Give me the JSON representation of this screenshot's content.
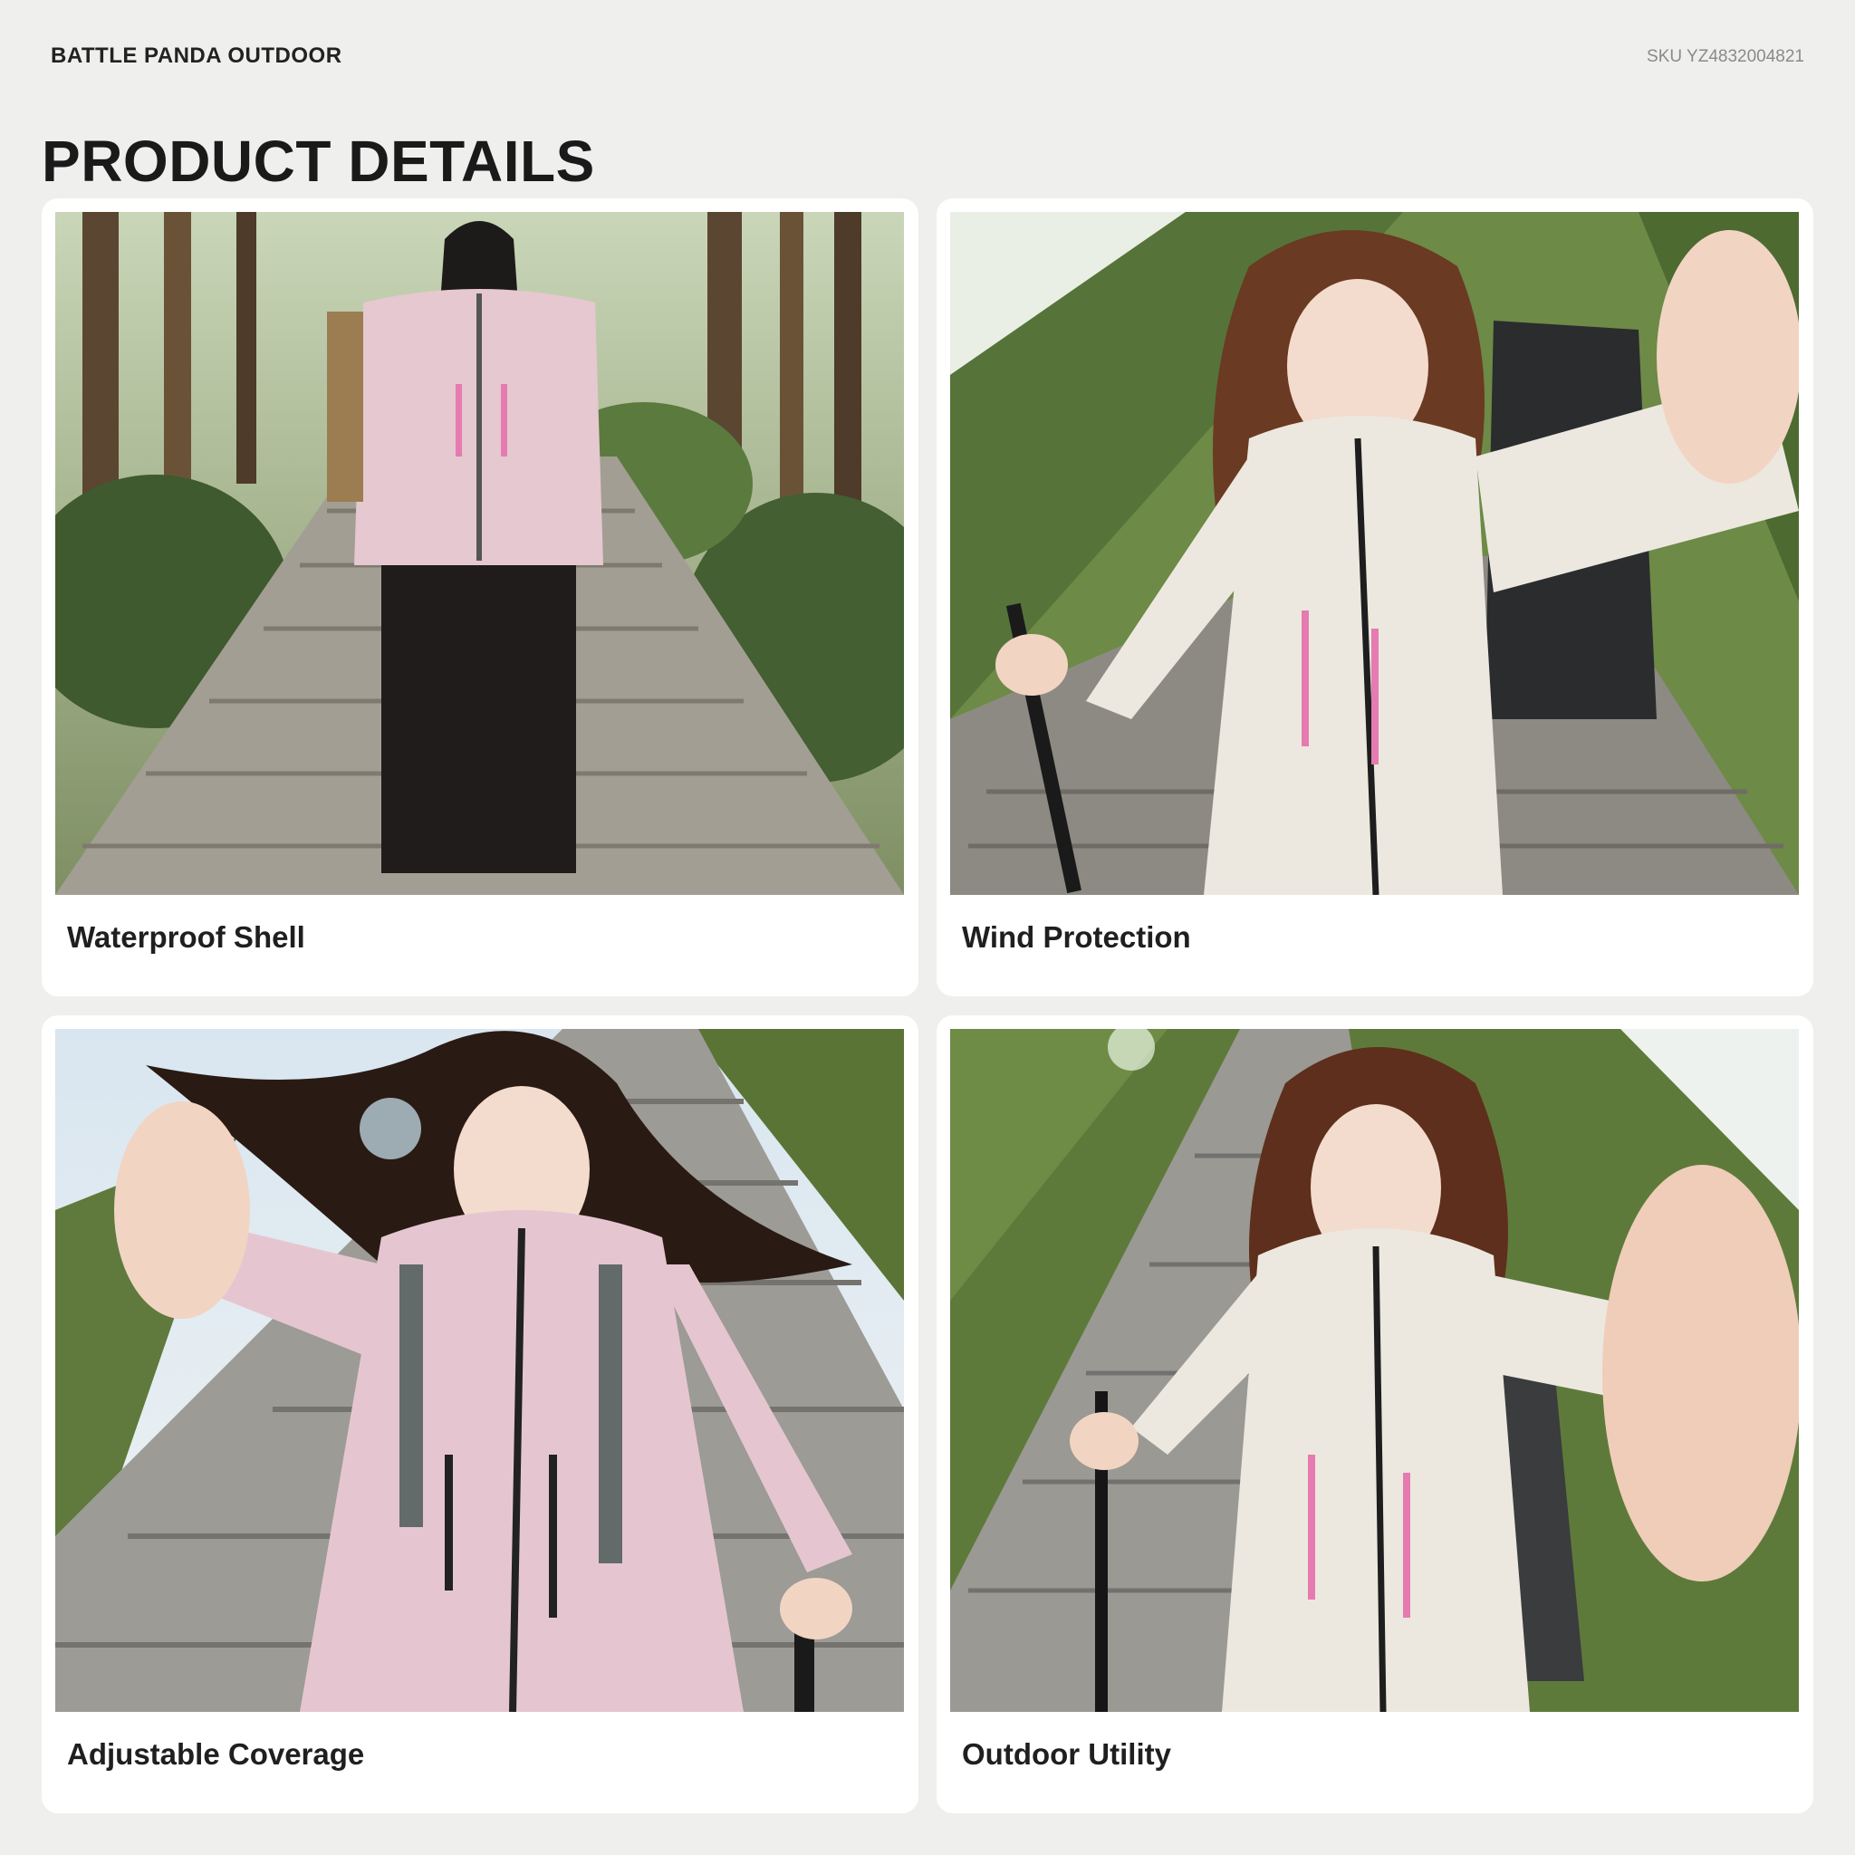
{
  "header": {
    "brand": "BATTLE PANDA OUTDOOR",
    "sku": "SKU YZ4832004821"
  },
  "page_title": "PRODUCT DETAILS",
  "cards": [
    {
      "caption": "Waterproof Shell",
      "photo_description_icon": "hiker-pink-jacket-forest-stairs",
      "jacket_color": "#e6c8d0",
      "accent_color": "#e57bb0"
    },
    {
      "caption": "Wind Protection",
      "photo_description_icon": "hiker-white-jacket-selfie-hillside",
      "jacket_color": "#ece8df",
      "accent_color": "#e57bb0"
    },
    {
      "caption": "Adjustable Coverage",
      "photo_description_icon": "hiker-pink-jacket-stone-stairs",
      "jacket_color": "#e5c6d0",
      "accent_color": "#222222"
    },
    {
      "caption": "Outdoor Utility",
      "photo_description_icon": "hiker-white-jacket-trekking-pole",
      "jacket_color": "#ece8df",
      "accent_color": "#e57bb0"
    }
  ]
}
